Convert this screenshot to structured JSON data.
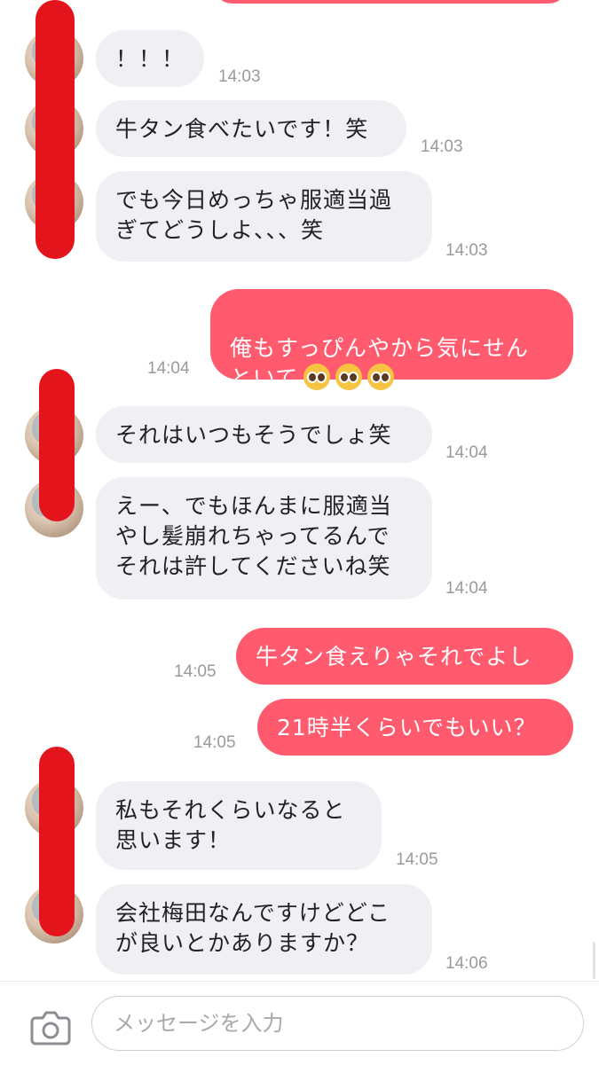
{
  "messages": [
    {
      "id": "m0",
      "side": "out",
      "text": "",
      "time": ""
    },
    {
      "id": "m1",
      "side": "in",
      "text": "！！！",
      "time": "14:03"
    },
    {
      "id": "m2",
      "side": "in",
      "text": "牛タン食べたいです！笑",
      "time": "14:03"
    },
    {
      "id": "m3",
      "side": "in",
      "text": "でも今日めっちゃ服適当過\nぎてどうしよ、、、笑",
      "time": "14:03"
    },
    {
      "id": "m4",
      "side": "out",
      "text": "俺もすっぴんやから気にせん\nといて",
      "emoji": "🥺🥺🥺",
      "time": "14:04"
    },
    {
      "id": "m5",
      "side": "in",
      "text": "それはいつもそうでしょ笑",
      "time": "14:04"
    },
    {
      "id": "m6",
      "side": "in",
      "text": "えー、でもほんまに服適当\nやし髪崩れちゃってるんで\nそれは許してくださいね笑",
      "time": "14:04"
    },
    {
      "id": "m7",
      "side": "out",
      "text": "牛タン食えりゃそれでよし",
      "time": "14:05"
    },
    {
      "id": "m8",
      "side": "out",
      "text": "21時半くらいでもいい？",
      "time": "14:05"
    },
    {
      "id": "m9",
      "side": "in",
      "text": "私もそれくらいなると\n思います！",
      "time": "14:05"
    },
    {
      "id": "m10",
      "side": "in",
      "text": "会社梅田なんですけどどこ\nが良いとかありますか？",
      "time": "14:06"
    }
  ],
  "composer": {
    "placeholder": "メッセージを入力",
    "camera_icon": "camera-icon"
  },
  "colors": {
    "outgoing_bubble": "#ff5a6e",
    "incoming_bubble": "#efeff4",
    "redaction": "#e3141b",
    "timestamp": "#9a9a9a"
  }
}
